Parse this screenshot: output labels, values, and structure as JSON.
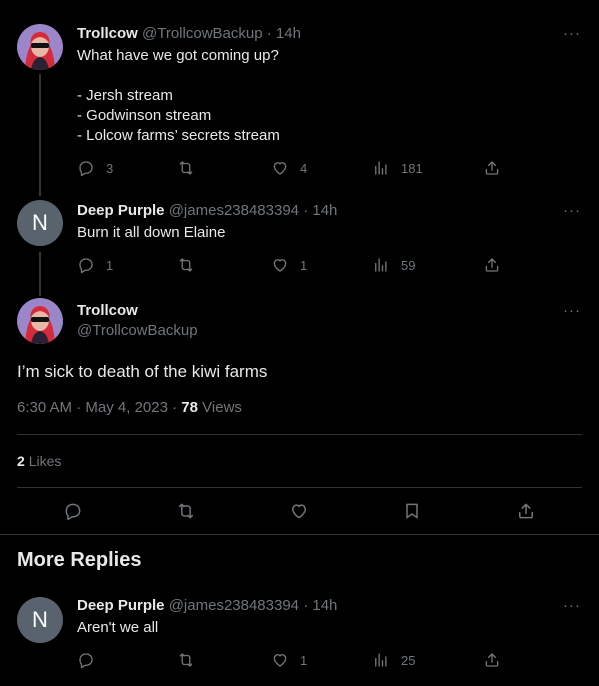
{
  "tweet1": {
    "display_name": "Trollcow",
    "handle": "@TrollcowBackup",
    "time": "14h",
    "lines": [
      "What have we got coming up?",
      "",
      "- Jersh stream",
      "- Godwinson stream",
      "- Lolcow farms’ secrets stream"
    ],
    "replies": "3",
    "retweets": "",
    "likes": "4",
    "views": "181"
  },
  "tweet2": {
    "avatar_letter": "N",
    "display_name": "Deep Purple",
    "handle": "@james238483394",
    "time": "14h",
    "text": "Burn it all down Elaine",
    "replies": "1",
    "retweets": "",
    "likes": "1",
    "views": "59"
  },
  "main_tweet": {
    "display_name": "Trollcow",
    "handle": "@TrollcowBackup",
    "text": "I’m sick to death of the kiwi farms",
    "time": "6:30 AM",
    "date": "May 4, 2023",
    "views_count": "78",
    "views_label": "Views",
    "likes_count": "2",
    "likes_label": "Likes"
  },
  "more_replies": {
    "title": "More Replies"
  },
  "reply": {
    "avatar_letter": "N",
    "display_name": "Deep Purple",
    "handle": "@james238483394",
    "time": "14h",
    "text": "Aren't we all",
    "replies": "",
    "retweets": "",
    "likes": "1",
    "views": "25"
  },
  "icons": {
    "more": "···",
    "dot_sep": "·"
  }
}
